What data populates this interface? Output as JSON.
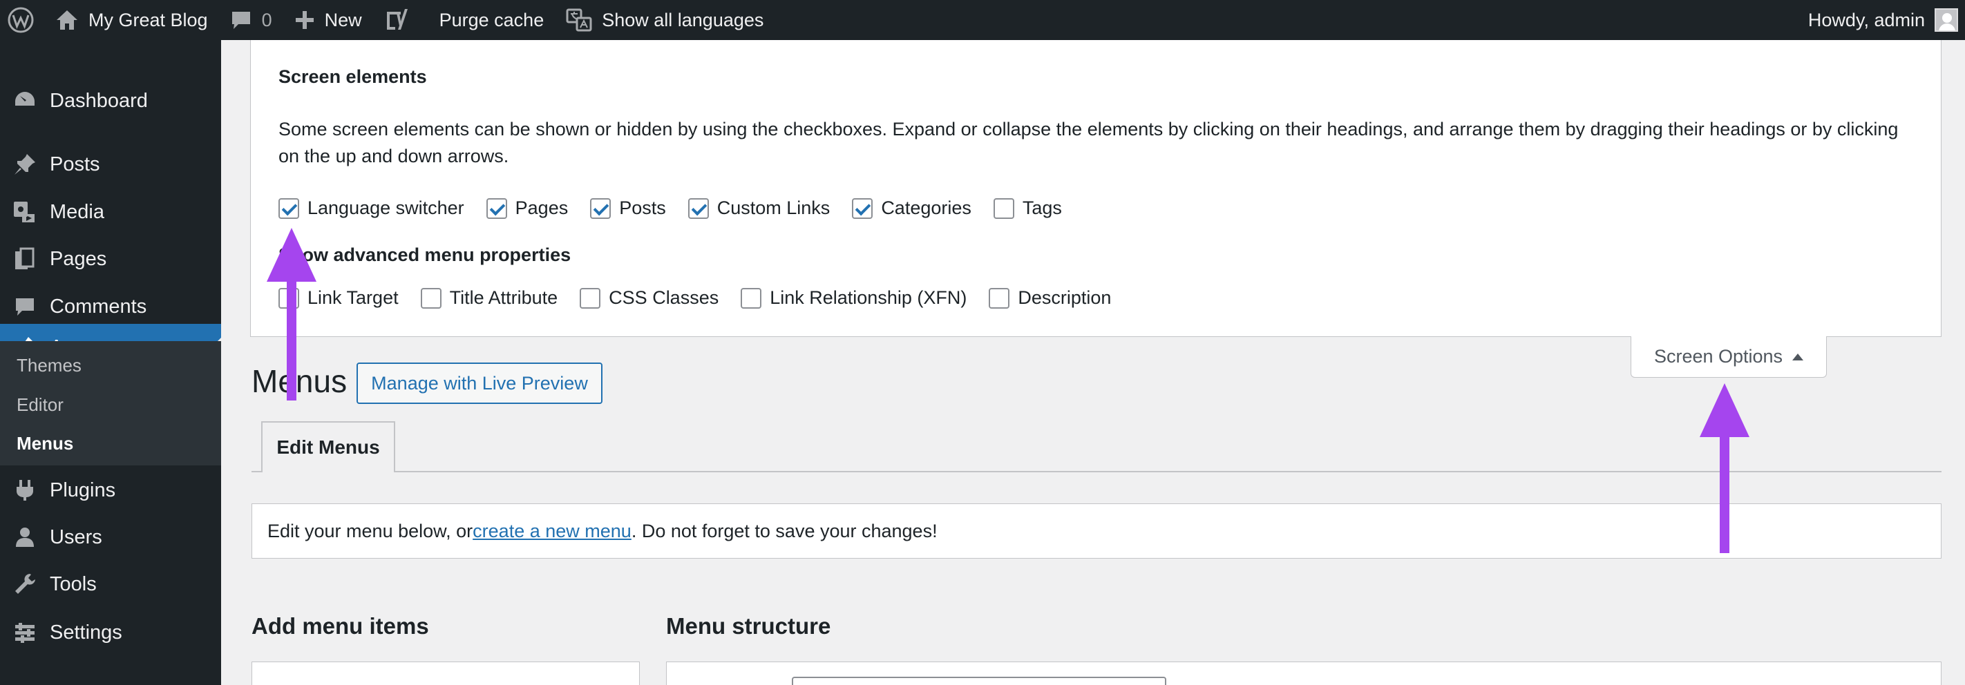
{
  "admin_bar": {
    "site_name": "My Great Blog",
    "comments_count": "0",
    "new_label": "New",
    "purge_cache_label": "Purge cache",
    "show_languages_label": "Show all languages",
    "howdy_label": "Howdy, admin"
  },
  "sidebar": {
    "items": [
      {
        "label": "Dashboard",
        "icon": "dashboard-icon"
      },
      {
        "label": "Posts",
        "icon": "pin-icon"
      },
      {
        "label": "Media",
        "icon": "media-icon"
      },
      {
        "label": "Pages",
        "icon": "pages-icon"
      },
      {
        "label": "Comments",
        "icon": "comment-icon"
      },
      {
        "label": "Appearance",
        "icon": "paintbrush-icon"
      },
      {
        "label": "Plugins",
        "icon": "plugin-icon"
      },
      {
        "label": "Users",
        "icon": "user-icon"
      },
      {
        "label": "Tools",
        "icon": "wrench-icon"
      },
      {
        "label": "Settings",
        "icon": "settings-icon"
      }
    ],
    "appearance_submenu": [
      "Themes",
      "Editor",
      "Menus"
    ]
  },
  "screen_options": {
    "heading": "Screen elements",
    "description": "Some screen elements can be shown or hidden by using the checkboxes. Expand or collapse the elements by clicking on their headings, and arrange them by dragging their headings or by clicking on the up and down arrows.",
    "elements": [
      {
        "label": "Language switcher",
        "checked": true
      },
      {
        "label": "Pages",
        "checked": true
      },
      {
        "label": "Posts",
        "checked": true
      },
      {
        "label": "Custom Links",
        "checked": true
      },
      {
        "label": "Categories",
        "checked": true
      },
      {
        "label": "Tags",
        "checked": false
      }
    ],
    "advanced_heading": "Show advanced menu properties",
    "advanced": [
      {
        "label": "Link Target",
        "checked": false
      },
      {
        "label": "Title Attribute",
        "checked": false
      },
      {
        "label": "CSS Classes",
        "checked": false
      },
      {
        "label": "Link Relationship (XFN)",
        "checked": false
      },
      {
        "label": "Description",
        "checked": false
      }
    ],
    "tab_label": "Screen Options"
  },
  "main": {
    "page_title": "Menus",
    "live_preview_label": "Manage with Live Preview",
    "tabs": [
      "Edit Menus"
    ],
    "notice_before": "Edit your menu below, or ",
    "notice_link": "create a new menu",
    "notice_after": ". Do not forget to save your changes!",
    "add_items_title": "Add menu items",
    "structure_title": "Menu structure"
  },
  "colors": {
    "admin_dark": "#1d2327",
    "accent": "#2271b1",
    "annotation_arrow": "#a545ee"
  }
}
